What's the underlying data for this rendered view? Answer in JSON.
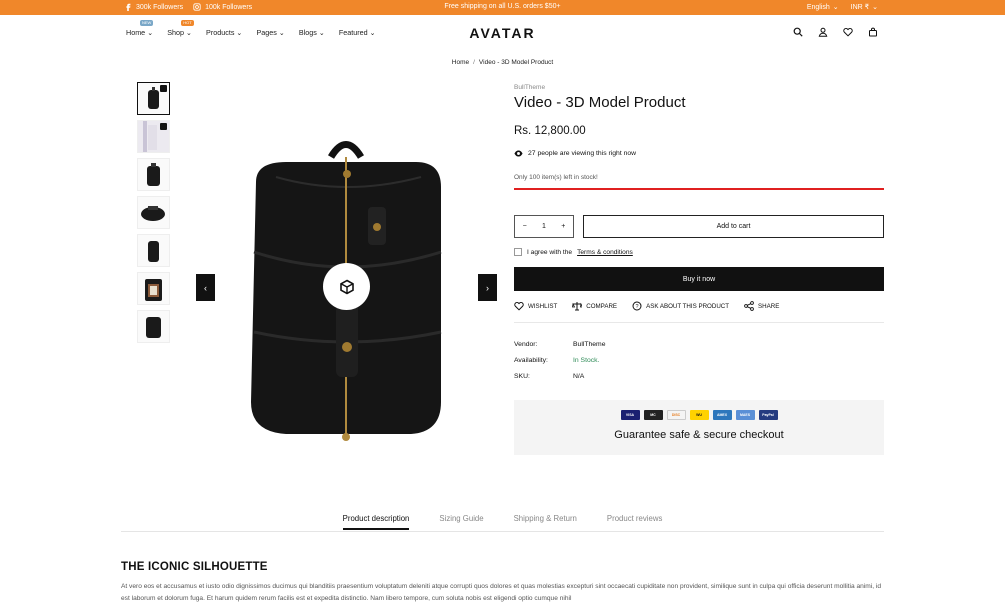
{
  "topbar": {
    "facebook_followers": "300k Followers",
    "instagram_followers": "100k Followers",
    "promo": "Free shipping on all U.S. orders $50+",
    "language": "English",
    "currency": "INR ₹",
    "color": "#f0872a"
  },
  "nav": {
    "items": [
      {
        "label": "Home",
        "badge": "NEW",
        "badge_color": "#7aa7c7"
      },
      {
        "label": "Shop",
        "badge": "HOT",
        "badge_color": "#f0872a"
      },
      {
        "label": "Products"
      },
      {
        "label": "Pages"
      },
      {
        "label": "Blogs"
      },
      {
        "label": "Featured"
      }
    ],
    "logo": "AVATAR"
  },
  "breadcrumb": {
    "home": "Home",
    "current": "Video - 3D Model Product"
  },
  "product": {
    "vendor_top": "BullTheme",
    "title": "Video - 3D Model Product",
    "price": "Rs. 12,800.00",
    "viewing": "27 people are viewing this right now",
    "stock_text": "Only 100 item(s) left in stock!",
    "quantity": "1",
    "add_to_cart": "Add to cart",
    "agree_prefix": "I agree with the",
    "terms_link": "Terms & conditions",
    "buy_now": "Buy it now",
    "actions": {
      "wishlist": "WISHLIST",
      "compare": "COMPARE",
      "ask": "ASK ABOUT THIS PRODUCT",
      "share": "SHARE"
    },
    "meta": {
      "vendor_label": "Vendor:",
      "vendor_value": "BullTheme",
      "availability_label": "Availability:",
      "availability_value": "In Stock.",
      "sku_label": "SKU:",
      "sku_value": "N/A"
    },
    "guarantee": "Guarantee safe & secure checkout",
    "payment_cards": [
      "VISA",
      "MC",
      "DISC",
      "WU",
      "AMEX",
      "MAES",
      "PayPal"
    ]
  },
  "tabs": [
    "Product description",
    "Sizing Guide",
    "Shipping & Return",
    "Product reviews"
  ],
  "description": {
    "heading": "THE ICONIC SILHOUETTE",
    "text": "At vero eos et accusamus et iusto odio dignissimos ducimus qui blanditiis praesentium voluptatum deleniti atque corrupti quos dolores et quas molestias excepturi sint occaecati cupiditate non provident, similique sunt in culpa qui officia deserunt mollitia animi, id est laborum et dolorum fuga. Et harum quidem rerum facilis est et expedita distinctio. Nam libero tempore, cum soluta nobis est eligendi optio cumque nihil"
  }
}
